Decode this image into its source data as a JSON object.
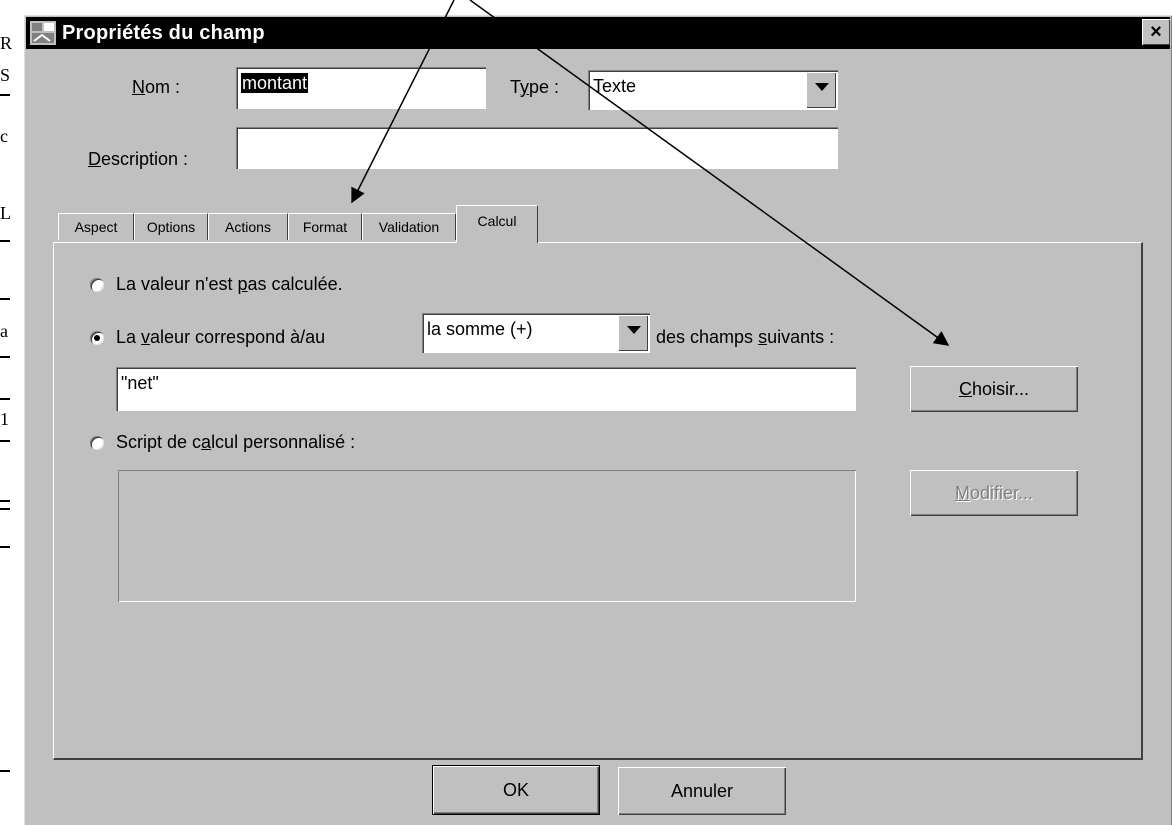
{
  "dialog": {
    "title": "Propriétés du champ",
    "close_glyph": "×"
  },
  "form": {
    "nom": {
      "label_pre": "",
      "label_accel": "N",
      "label_post": "om :",
      "value": "montant"
    },
    "type": {
      "label_pre": "T",
      "label_accel": "y",
      "label_post": "pe :",
      "value": "Texte"
    },
    "description": {
      "label_pre": "",
      "label_accel": "D",
      "label_post": "escription :",
      "value": ""
    }
  },
  "tabs": [
    "Aspect",
    "Options",
    "Actions",
    "Format",
    "Validation",
    "Calcul"
  ],
  "active_tab": "Calcul",
  "calcul": {
    "option1": {
      "pre": "La valeur n'est ",
      "accel": "p",
      "post": "as calculée.",
      "selected": false
    },
    "option2": {
      "pre": "La ",
      "accel": "v",
      "post": "aleur correspond à/au",
      "selected": true
    },
    "operation": "la somme (+)",
    "fields_label": {
      "pre": "des champs ",
      "accel": "s",
      "post": "uivants :"
    },
    "fields_value": "\"net\"",
    "choose_button": {
      "accel": "C",
      "post": "hoisir..."
    },
    "option3": {
      "pre": "Script de c",
      "accel": "a",
      "post": "lcul personnalisé :",
      "selected": false
    },
    "script_value": "",
    "modify_button": {
      "accel": "M",
      "post": "odifier..."
    }
  },
  "buttons": {
    "ok": "OK",
    "cancel": "Annuler"
  },
  "background_fragments": [
    "R",
    "S",
    "c",
    "L",
    "a",
    "1"
  ]
}
